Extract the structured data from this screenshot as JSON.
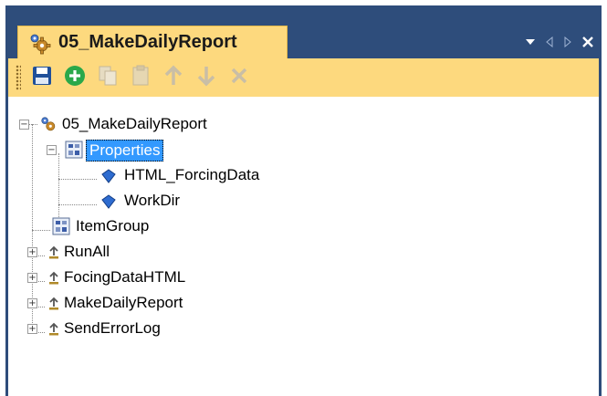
{
  "window": {
    "tab_title": "05_MakeDailyReport",
    "controls": [
      "dropdown-icon",
      "scroll-left-icon",
      "scroll-right-icon",
      "close-icon"
    ]
  },
  "toolbar": {
    "buttons": [
      {
        "name": "save",
        "icon": "save-icon",
        "enabled": true
      },
      {
        "name": "add",
        "icon": "plus-circle-icon",
        "enabled": true
      },
      {
        "name": "copy",
        "icon": "copy-icon",
        "enabled": false
      },
      {
        "name": "paste",
        "icon": "paste-icon",
        "enabled": false
      },
      {
        "name": "move-up",
        "icon": "arrow-up-icon",
        "enabled": false
      },
      {
        "name": "move-down",
        "icon": "arrow-down-icon",
        "enabled": false
      },
      {
        "name": "delete",
        "icon": "delete-icon",
        "enabled": false
      }
    ]
  },
  "tree": {
    "root": "05_MakeDailyReport",
    "properties": "Properties",
    "property_items": [
      "HTML_ForcingData",
      "WorkDir"
    ],
    "item_group": "ItemGroup",
    "targets": [
      "RunAll",
      "FocingDataHTML",
      "MakeDailyReport",
      "SendErrorLog"
    ]
  },
  "colors": {
    "frame": "#2e4d7b",
    "tab_active": "#fdd97e",
    "selection": "#3399ff"
  }
}
